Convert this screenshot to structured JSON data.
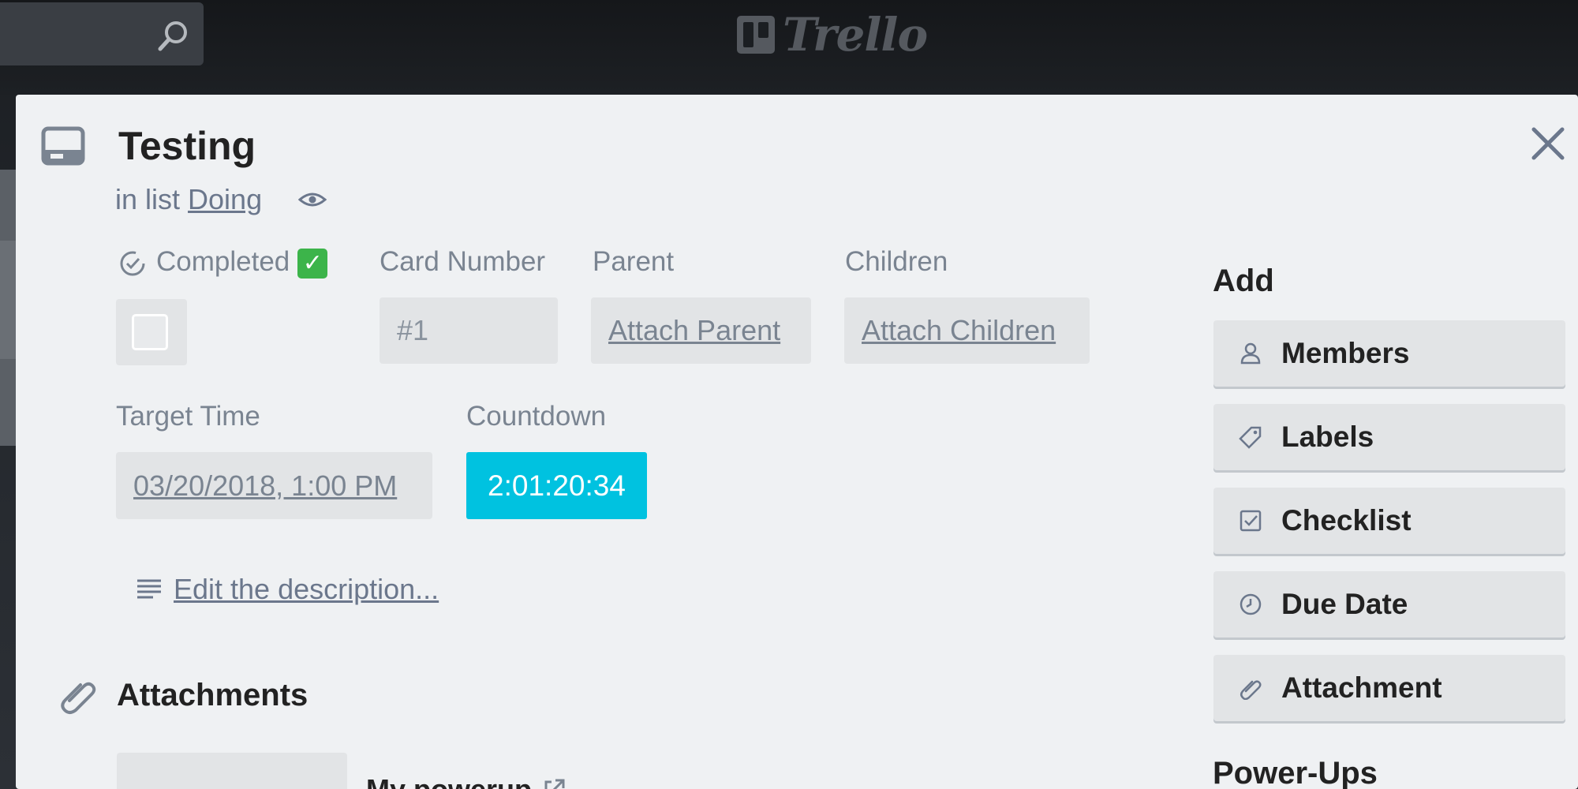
{
  "header": {
    "logo_text": "Trello",
    "search_icon": "search-icon"
  },
  "card": {
    "title": "Testing",
    "in_list_prefix": "in list",
    "list_name": "Doing",
    "icons": {
      "card": "card-icon",
      "watch": "eye-icon",
      "close": "close-icon"
    }
  },
  "fields": {
    "completed": {
      "label": "Completed",
      "emoji": "✅",
      "checked": false
    },
    "card_number": {
      "label": "Card Number",
      "value": "#1"
    },
    "parent": {
      "label": "Parent",
      "link": "Attach Parent"
    },
    "children": {
      "label": "Children",
      "link": "Attach Children"
    },
    "target_time": {
      "label": "Target Time",
      "value": "03/20/2018, 1:00 PM"
    },
    "countdown": {
      "label": "Countdown",
      "value": "2:01:20:34",
      "color": "#00c2e0"
    }
  },
  "description": {
    "link": "Edit the description..."
  },
  "attachments": {
    "title": "Attachments",
    "items": [
      {
        "name": "My powerup"
      }
    ]
  },
  "sidebar": {
    "add_title": "Add",
    "buttons": [
      {
        "label": "Members",
        "icon": "person-icon"
      },
      {
        "label": "Labels",
        "icon": "tag-icon"
      },
      {
        "label": "Checklist",
        "icon": "checklist-icon"
      },
      {
        "label": "Due Date",
        "icon": "clock-icon"
      },
      {
        "label": "Attachment",
        "icon": "paperclip-icon"
      }
    ],
    "powerups_title": "Power-Ups"
  },
  "colors": {
    "countdown": "#00c2e0",
    "modal_bg": "#eff1f3",
    "button_bg": "#e2e4e6"
  }
}
